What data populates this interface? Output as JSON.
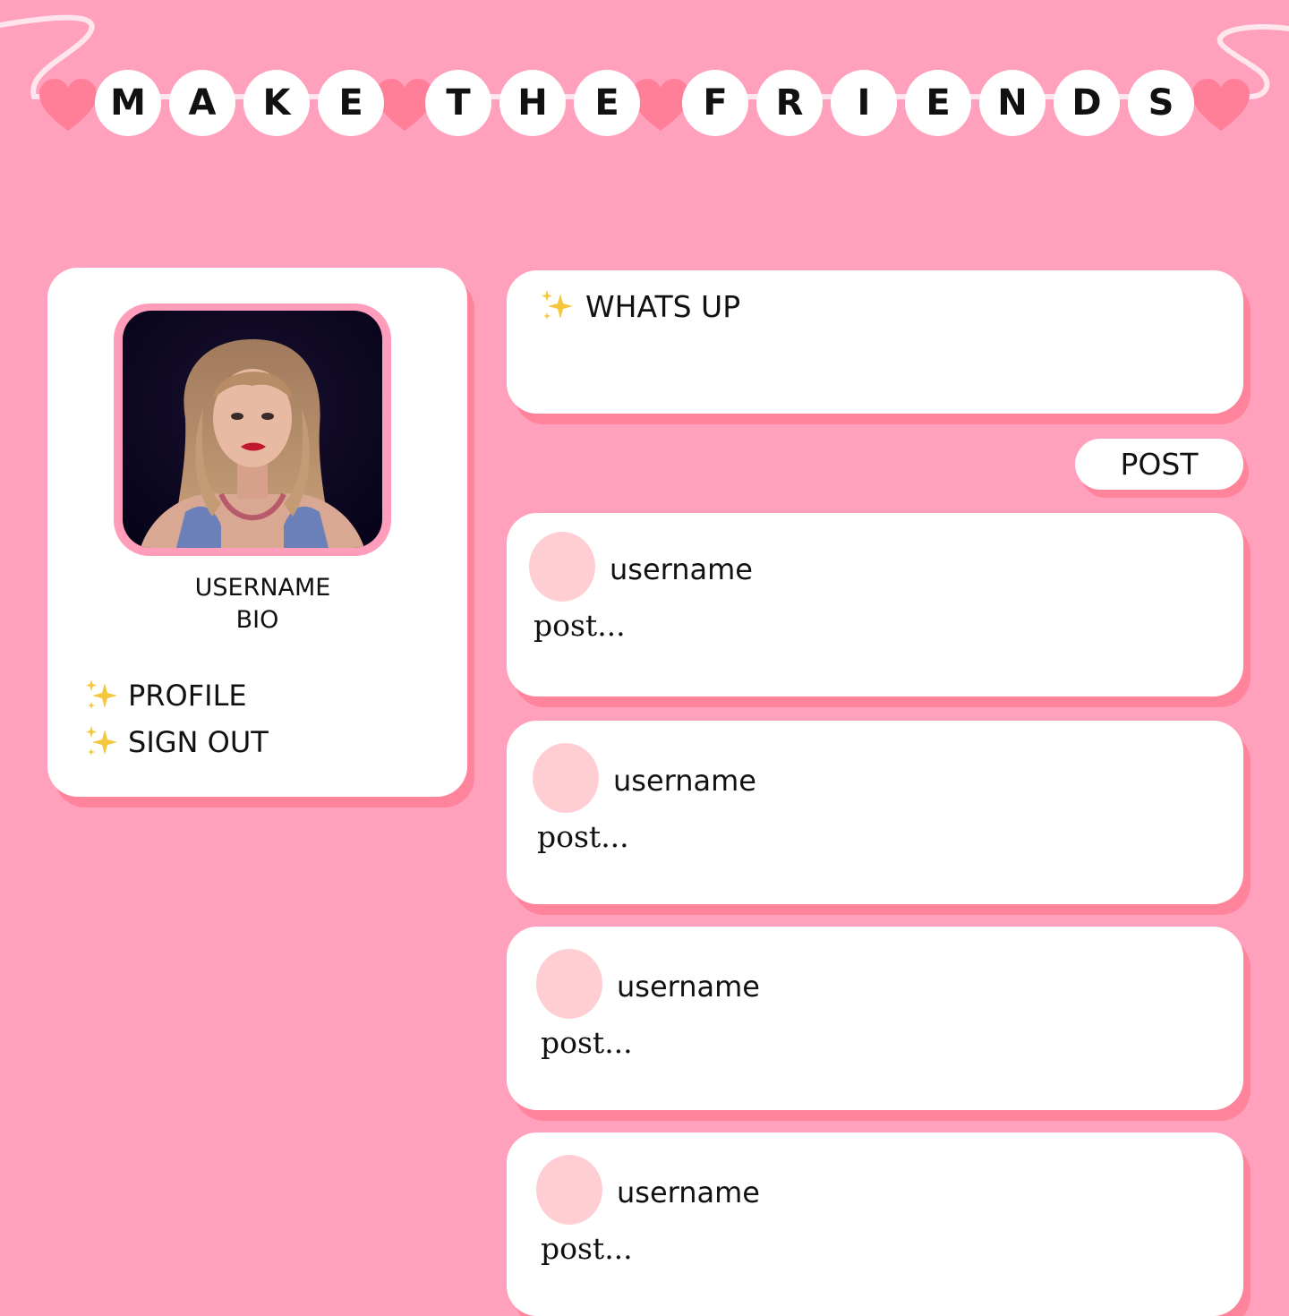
{
  "header": {
    "title_letters": [
      "M",
      "A",
      "K",
      "E",
      "T",
      "H",
      "E",
      "F",
      "R",
      "I",
      "E",
      "N",
      "D",
      "S"
    ],
    "title_aria": "MAKE THE FRIENDS",
    "colors": {
      "background": "#ffa0bd",
      "heart": "#ff7f98",
      "bead": "#ffffff",
      "string": "#ffe6ee"
    }
  },
  "profile": {
    "username": "USERNAME",
    "bio": "BIO",
    "photo_alt": "profile photo",
    "menu": [
      {
        "icon": "sparkles-icon",
        "label": "PROFILE"
      },
      {
        "icon": "sparkles-icon",
        "label": "SIGN OUT"
      }
    ]
  },
  "composer": {
    "icon": "sparkles-icon",
    "placeholder": "WHATS UP",
    "post_button": "POST"
  },
  "feed": {
    "posts": [
      {
        "username": "username",
        "text": "post..."
      },
      {
        "username": "username",
        "text": "post..."
      },
      {
        "username": "username",
        "text": "post..."
      },
      {
        "username": "username",
        "text": "post..."
      }
    ]
  }
}
